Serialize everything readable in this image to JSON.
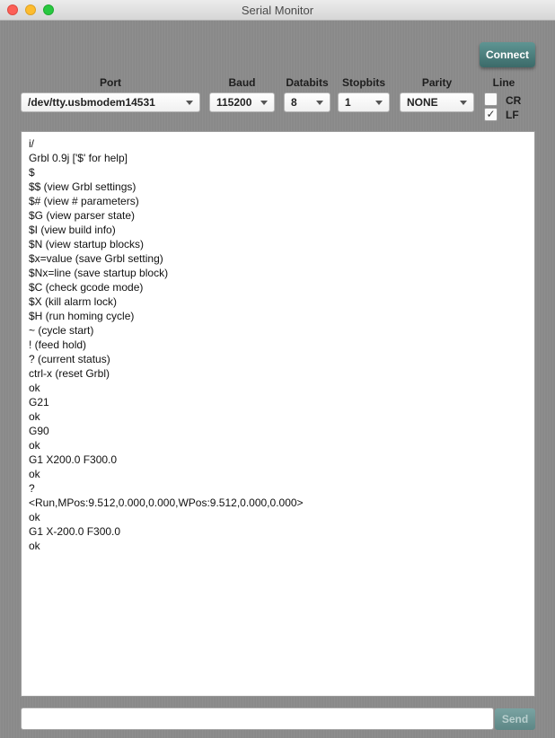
{
  "window": {
    "title": "Serial Monitor"
  },
  "toolbar": {
    "connect_label": "Connect",
    "port_label": "Port",
    "port_value": "/dev/tty.usbmodem14531",
    "baud_label": "Baud",
    "baud_value": "115200",
    "databits_label": "Databits",
    "databits_value": "8",
    "stopbits_label": "Stopbits",
    "stopbits_value": "1",
    "parity_label": "Parity",
    "parity_value": "NONE",
    "line_label": "Line",
    "cr_label": "CR",
    "cr_checked": false,
    "lf_label": "LF",
    "lf_checked": true,
    "check_mark": "✓"
  },
  "output": {
    "lines": [
      "i/",
      "Grbl 0.9j ['$' for help]",
      "$",
      "$$ (view Grbl settings)",
      "$# (view # parameters)",
      "$G (view parser state)",
      "$I (view build info)",
      "$N (view startup blocks)",
      "$x=value (save Grbl setting)",
      "$Nx=line (save startup block)",
      "$C (check gcode mode)",
      "$X (kill alarm lock)",
      "$H (run homing cycle)",
      "~ (cycle start)",
      "! (feed hold)",
      "? (current status)",
      "ctrl-x (reset Grbl)",
      "ok",
      "G21",
      "ok",
      "G90",
      "ok",
      "G1 X200.0 F300.0",
      "ok",
      "?",
      "<Run,MPos:9.512,0.000,0.000,WPos:9.512,0.000,0.000>",
      "ok",
      "G1 X-200.0 F300.0",
      "ok"
    ]
  },
  "command": {
    "input_value": "",
    "send_label": "Send"
  },
  "colors": {
    "window_bg": "#8a8a8a",
    "connect_bg": "#4a7c7b",
    "send_bg": "#6b9594"
  }
}
